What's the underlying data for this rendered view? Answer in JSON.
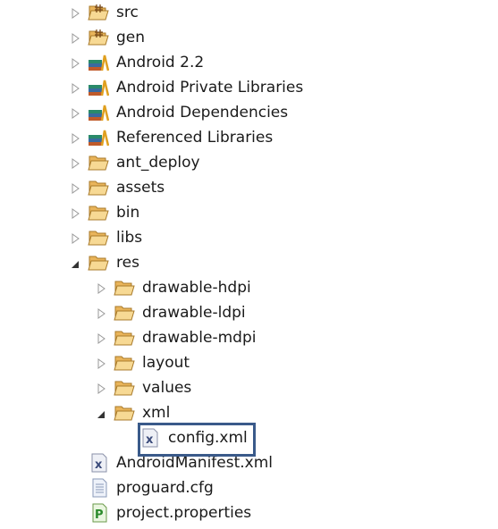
{
  "tree": [
    {
      "label": "src",
      "level": 0,
      "icon": "source-folder-icon",
      "state": "collapsed"
    },
    {
      "label": "gen",
      "level": 0,
      "icon": "source-folder-icon",
      "state": "collapsed"
    },
    {
      "label": "Android 2.2",
      "level": 0,
      "icon": "library-icon",
      "state": "collapsed"
    },
    {
      "label": "Android Private Libraries",
      "level": 0,
      "icon": "library-icon",
      "state": "collapsed"
    },
    {
      "label": "Android Dependencies",
      "level": 0,
      "icon": "library-icon",
      "state": "collapsed"
    },
    {
      "label": "Referenced Libraries",
      "level": 0,
      "icon": "library-icon",
      "state": "collapsed"
    },
    {
      "label": "ant_deploy",
      "level": 0,
      "icon": "folder-icon",
      "state": "collapsed"
    },
    {
      "label": "assets",
      "level": 0,
      "icon": "folder-icon",
      "state": "collapsed"
    },
    {
      "label": "bin",
      "level": 0,
      "icon": "folder-icon",
      "state": "collapsed"
    },
    {
      "label": "libs",
      "level": 0,
      "icon": "folder-icon",
      "state": "collapsed"
    },
    {
      "label": "res",
      "level": 0,
      "icon": "folder-icon",
      "state": "expanded"
    },
    {
      "label": "drawable-hdpi",
      "level": 1,
      "icon": "folder-icon",
      "state": "collapsed"
    },
    {
      "label": "drawable-ldpi",
      "level": 1,
      "icon": "folder-icon",
      "state": "collapsed"
    },
    {
      "label": "drawable-mdpi",
      "level": 1,
      "icon": "folder-icon",
      "state": "collapsed"
    },
    {
      "label": "layout",
      "level": 1,
      "icon": "folder-icon",
      "state": "collapsed"
    },
    {
      "label": "values",
      "level": 1,
      "icon": "folder-icon",
      "state": "collapsed"
    },
    {
      "label": "xml",
      "level": 1,
      "icon": "folder-icon",
      "state": "expanded"
    },
    {
      "label": "config.xml",
      "level": 2,
      "icon": "xml-file-icon",
      "state": "leaf",
      "highlighted": true
    },
    {
      "label": "AndroidManifest.xml",
      "level": 0,
      "icon": "xml-file-icon",
      "state": "leaf"
    },
    {
      "label": "proguard.cfg",
      "level": 0,
      "icon": "text-file-icon",
      "state": "leaf"
    },
    {
      "label": "project.properties",
      "level": 0,
      "icon": "properties-file-icon",
      "state": "leaf"
    }
  ],
  "colors": {
    "highlight_border": "#3a5a8a",
    "folder": "#f2c77a"
  }
}
